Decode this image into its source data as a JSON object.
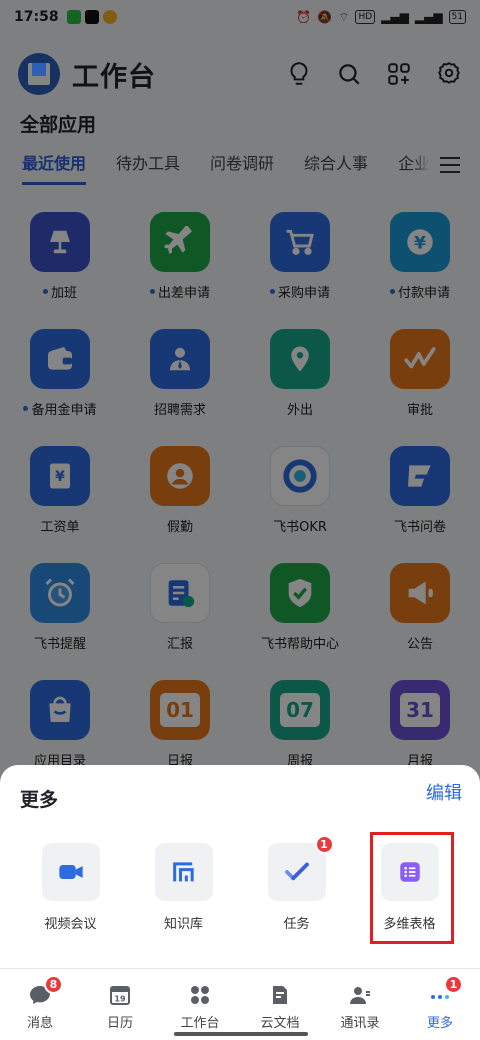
{
  "status_bar": {
    "time": "17:58",
    "battery": "51",
    "network": "HD"
  },
  "header": {
    "title": "工作台"
  },
  "section_title": "全部应用",
  "tabs": [
    {
      "label": "最近使用"
    },
    {
      "label": "待办工具"
    },
    {
      "label": "问卷调研"
    },
    {
      "label": "综合人事"
    },
    {
      "label": "企业"
    }
  ],
  "apps": [
    {
      "label": "加班",
      "dot": true,
      "color": "#3a53c8",
      "icon": "lamp-icon"
    },
    {
      "label": "出差申请",
      "dot": true,
      "color": "#1fa84a",
      "icon": "airplane-icon"
    },
    {
      "label": "采购申请",
      "dot": true,
      "color": "#2f6be0",
      "icon": "cart-icon"
    },
    {
      "label": "付款申请",
      "dot": true,
      "color": "#1c9ad6",
      "icon": "yen-coin-icon"
    },
    {
      "label": "备用金申请",
      "dot": true,
      "color": "#2f6be0",
      "icon": "wallet-icon"
    },
    {
      "label": "招聘需求",
      "dot": false,
      "color": "#2f6be0",
      "icon": "person-icon"
    },
    {
      "label": "外出",
      "dot": false,
      "color": "#17a88a",
      "icon": "location-pin-icon"
    },
    {
      "label": "审批",
      "dot": false,
      "color": "#e8781a",
      "icon": "approval-icon"
    },
    {
      "label": "工资单",
      "dot": false,
      "color": "#2f6be0",
      "icon": "payslip-icon"
    },
    {
      "label": "假勤",
      "dot": false,
      "color": "#e8781a",
      "icon": "attendance-icon"
    },
    {
      "label": "飞书OKR",
      "dot": false,
      "color": "#ffffff",
      "icon": "okr-target-icon"
    },
    {
      "label": "飞书问卷",
      "dot": false,
      "color": "#2f6be0",
      "icon": "survey-icon"
    },
    {
      "label": "飞书提醒",
      "dot": false,
      "color": "#2f8be0",
      "icon": "alarm-clock-icon"
    },
    {
      "label": "汇报",
      "dot": false,
      "color": "#ffffff",
      "icon": "report-icon"
    },
    {
      "label": "飞书帮助中心",
      "dot": false,
      "color": "#1fa84a",
      "icon": "help-shield-icon"
    },
    {
      "label": "公告",
      "dot": false,
      "color": "#e8781a",
      "icon": "megaphone-icon"
    },
    {
      "label": "应用目录",
      "dot": false,
      "color": "#2f6be0",
      "icon": "shopping-bag-icon"
    },
    {
      "label": "日报",
      "dot": false,
      "color": "#e8781a",
      "icon": "calendar-01-icon",
      "text": "01"
    },
    {
      "label": "周报",
      "dot": false,
      "color": "#17a88a",
      "icon": "calendar-07-icon",
      "text": "07"
    },
    {
      "label": "月报",
      "dot": false,
      "color": "#6b52d6",
      "icon": "calendar-31-icon",
      "text": "31"
    }
  ],
  "sheet": {
    "title": "更多",
    "edit_label": "编辑",
    "items": [
      {
        "label": "视频会议",
        "icon": "video-camera-icon"
      },
      {
        "label": "知识库",
        "icon": "knowledge-base-icon"
      },
      {
        "label": "任务",
        "icon": "task-check-icon",
        "badge": "1"
      },
      {
        "label": "多维表格",
        "icon": "multi-table-icon"
      }
    ]
  },
  "nav": [
    {
      "label": "消息",
      "icon": "message-icon",
      "badge": "8"
    },
    {
      "label": "日历",
      "icon": "calendar-icon",
      "text": "19"
    },
    {
      "label": "工作台",
      "icon": "workspace-icon"
    },
    {
      "label": "云文档",
      "icon": "cloud-doc-icon"
    },
    {
      "label": "通讯录",
      "icon": "contacts-icon"
    },
    {
      "label": "更多",
      "icon": "more-dots-icon",
      "badge": "1",
      "active": true
    }
  ]
}
